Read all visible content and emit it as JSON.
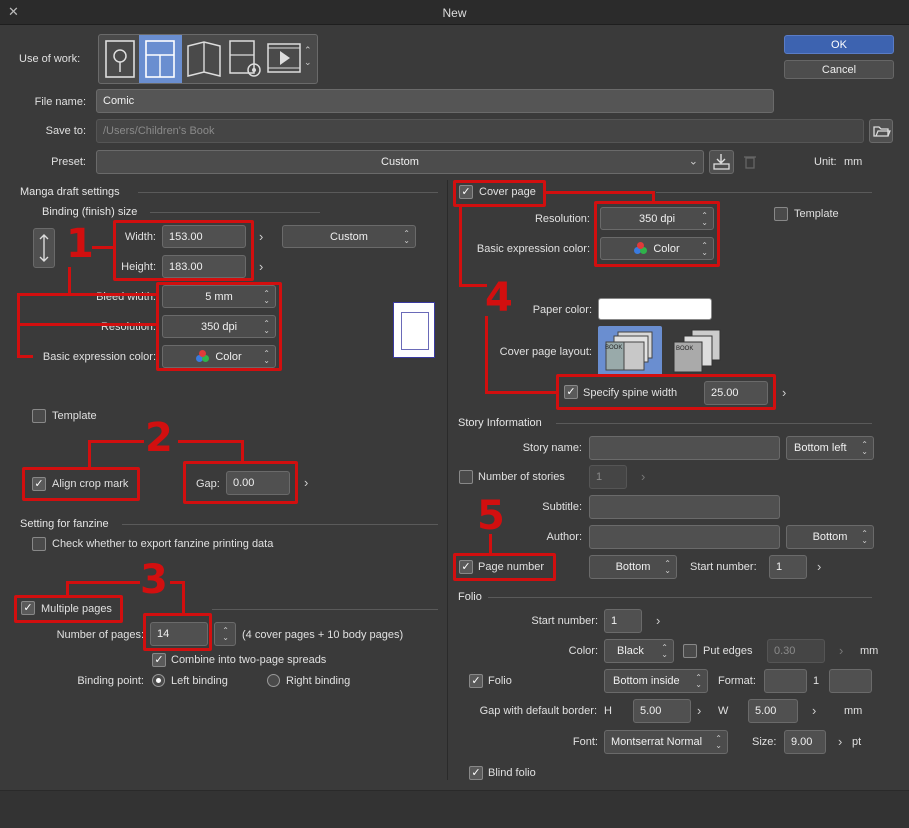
{
  "window": {
    "title": "New",
    "close": "✕"
  },
  "buttons": {
    "ok": "OK",
    "cancel": "Cancel"
  },
  "top": {
    "use_of_work_label": "Use of work:",
    "file_name_label": "File name:",
    "file_name_value": "Comic",
    "save_to_label": "Save to:",
    "save_to_value": "/Users/Children's Book",
    "preset_label": "Preset:",
    "preset_value": "Custom",
    "unit_label": "Unit:",
    "unit_value": "mm"
  },
  "left": {
    "manga_section": "Manga draft settings",
    "binding_section": "Binding (finish) size",
    "width_label": "Width:",
    "width_value": "153.00",
    "height_label": "Height:",
    "height_value": "183.00",
    "size_preset": "Custom",
    "bleed_label": "Bleed width:",
    "bleed_value": "5 mm",
    "resolution_label": "Resolution:",
    "resolution_value": "350 dpi",
    "color_label": "Basic expression color:",
    "color_value": "Color",
    "template_label": "Template",
    "crop_label": "Align crop mark",
    "gap_label": "Gap:",
    "gap_value": "0.00",
    "fanzine_section": "Setting for fanzine",
    "fanzine_check": "Check whether to export fanzine printing data",
    "multiple_pages": "Multiple pages",
    "num_pages_label": "Number of pages:",
    "num_pages_value": "14",
    "num_pages_note": "(4 cover pages + 10 body pages)",
    "combine_label": "Combine into two-page spreads",
    "binding_point_label": "Binding point:",
    "left_binding": "Left binding",
    "right_binding": "Right binding"
  },
  "right": {
    "cover_page": "Cover page",
    "resolution_label": "Resolution:",
    "resolution_value": "350 dpi",
    "template_label": "Template",
    "color_label": "Basic expression color:",
    "color_value": "Color",
    "paper_color_label": "Paper color:",
    "cover_layout_label": "Cover page layout:",
    "book_text": "BOOK",
    "spine_label": "Specify spine width",
    "spine_value": "25.00",
    "story_section": "Story Information",
    "story_name_label": "Story name:",
    "story_name_pos": "Bottom left",
    "num_stories_label": "Number of stories",
    "num_stories_value": "1",
    "subtitle_label": "Subtitle:",
    "author_label": "Author:",
    "author_pos": "Bottom",
    "page_number_label": "Page number",
    "page_number_pos": "Bottom",
    "start_number_label": "Start number:",
    "start_number_value": "1",
    "folio_section": "Folio",
    "folio_start_label": "Start number:",
    "folio_start_value": "1",
    "color_label2": "Color:",
    "color_value2": "Black",
    "put_edges_label": "Put edges",
    "put_edges_value": "0.30",
    "mm1": "mm",
    "folio_label": "Folio",
    "folio_pos": "Bottom inside",
    "format_label": "Format:",
    "format_num": "1",
    "gap_border_label": "Gap with default border:",
    "h_label": "H",
    "h_value": "5.00",
    "w_label": "W",
    "w_value": "5.00",
    "mm2": "mm",
    "font_label": "Font:",
    "font_value": "Montserrat Normal",
    "size_label": "Size:",
    "size_value": "9.00",
    "pt": "pt",
    "blind_folio": "Blind folio"
  },
  "annotations": [
    "1",
    "2",
    "3",
    "4",
    "5"
  ],
  "colors": {
    "accent": "#3d63b0",
    "annotation": "#d20f0f",
    "background": "#3a3a3a",
    "titlebar": "#2b2b2b"
  }
}
